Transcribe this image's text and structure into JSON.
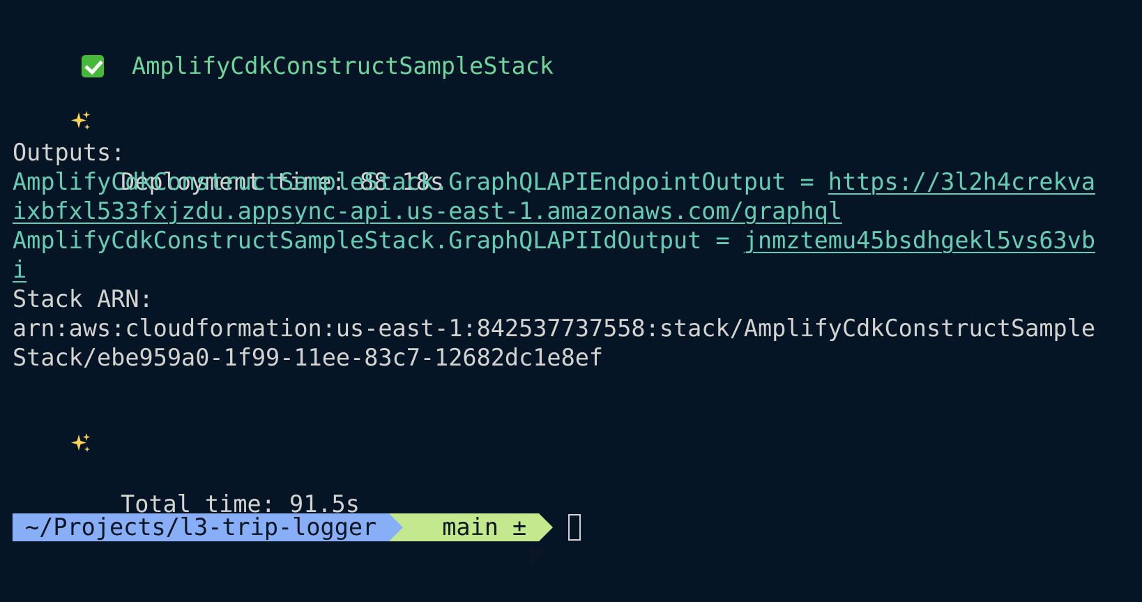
{
  "stack_name": "AmplifyCdkConstructSampleStack",
  "deployment_time": "Deployment time: 88.18s",
  "outputs_label": "Outputs:",
  "outputs": [
    {
      "key": "AmplifyCdkConstructSampleStack.GraphQLAPIEndpointOutput",
      "separator": " = ",
      "value_line1": "https://3l2h4crekva",
      "value_line2": "ixbfxl533fxjzdu.appsync-api.us-east-1.amazonaws.com/graphql"
    },
    {
      "key": "AmplifyCdkConstructSampleStack.GraphQLAPIIdOutput",
      "separator": " = ",
      "value_line1": "jnmztemu45bsdhgekl5vs63vb",
      "value_line2": "i"
    }
  ],
  "stack_arn_label": "Stack ARN:",
  "stack_arn_line1": "arn:aws:cloudformation:us-east-1:842537737558:stack/AmplifyCdkConstructSample",
  "stack_arn_line2": "Stack/ebe959a0-1f99-11ee-83c7-12682dc1e8ef",
  "total_time": "Total time: 91.5s",
  "prompt": {
    "path": "~/Projects/l3-trip-logger",
    "branch": "main ±",
    "branch_icon": "git-branch-icon",
    "path_color": "#88aef7",
    "branch_color": "#c3e88d"
  },
  "icons": {
    "success": "check-mark-icon",
    "sparkles": "sparkles-icon"
  },
  "colors": {
    "background": "#061526",
    "text": "#d3d3d0",
    "stack_name": "#6fd59a",
    "output": "#66cdb4"
  }
}
